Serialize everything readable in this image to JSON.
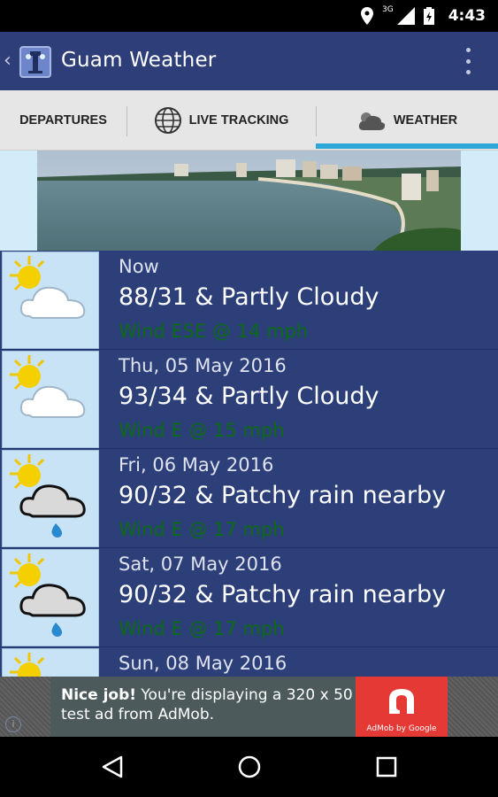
{
  "status_bar": {
    "time": "4:43",
    "network": "3G"
  },
  "app_bar": {
    "back": "‹",
    "title": "Guam Weather"
  },
  "tabs": [
    {
      "label": "DEPARTURES",
      "icon": "none"
    },
    {
      "label": "LIVE TRACKING",
      "icon": "globe-icon"
    },
    {
      "label": "WEATHER",
      "icon": "cloud-icon",
      "selected": true
    }
  ],
  "forecast": [
    {
      "date": "Now",
      "summary": "88/31 & Partly Cloudy",
      "wind": "Wind ESE @ 14 mph",
      "icon": "partly-cloudy-icon"
    },
    {
      "date": "Thu, 05 May 2016",
      "summary": "93/34 & Partly Cloudy",
      "wind": "Wind E @ 15 mph",
      "icon": "partly-cloudy-icon"
    },
    {
      "date": "Fri, 06 May 2016",
      "summary": "90/32 & Patchy rain nearby",
      "wind": "Wind E @ 17 mph",
      "icon": "patchy-rain-icon"
    },
    {
      "date": "Sat, 07 May 2016",
      "summary": "90/32 & Patchy rain nearby",
      "wind": "Wind E @ 17 mph",
      "icon": "patchy-rain-icon"
    },
    {
      "date": "Sun, 08 May 2016",
      "summary": "",
      "wind": "",
      "icon": "partly-cloudy-icon"
    }
  ],
  "ad": {
    "headline": "Nice job!",
    "body": " You're displaying a 320 x 50 test ad from AdMob.",
    "brand": "AdMob by Google",
    "info": "i"
  },
  "colors": {
    "app_bar": "#2d3e79",
    "row_bg": "#2d3f79",
    "wind_text": "#0b6a16",
    "tab_indicator": "#2ea6d8",
    "ad_red": "#e53935"
  }
}
